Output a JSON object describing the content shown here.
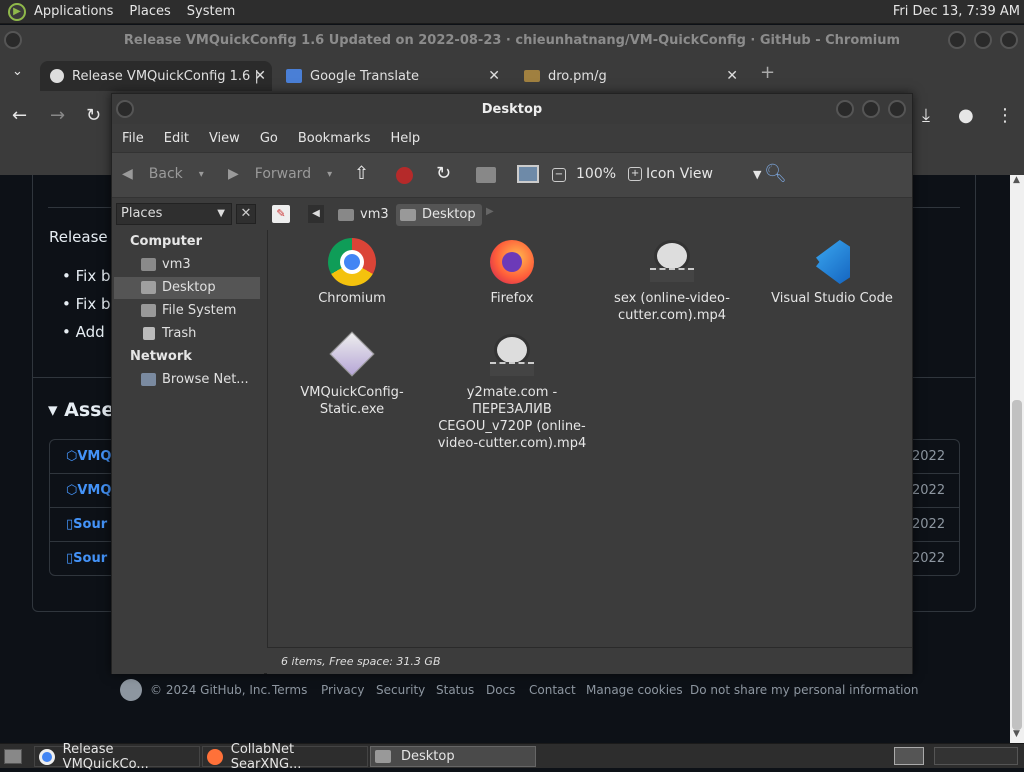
{
  "top_panel": {
    "applications": "Applications",
    "places": "Places",
    "system": "System",
    "clock": "Fri Dec 13,  7:39 AM"
  },
  "chromium": {
    "window_title": "Release VMQuickConfig 1.6 Updated on 2022-08-23 · chieunhatnang/VM-QuickConfig · GitHub - Chromium",
    "tabs": [
      {
        "label": "Release VMQuickConfig 1.6 |"
      },
      {
        "label": "Google Translate"
      },
      {
        "label": "dro.pm/g"
      }
    ]
  },
  "github": {
    "release_text": "Release",
    "bullets": [
      "Fix b",
      "Fix b",
      "Add"
    ],
    "assets_heading": "Asse",
    "assets": [
      {
        "name": "VMQ",
        "date": "2022"
      },
      {
        "name": "VMQ",
        "date": "2022"
      },
      {
        "name": "Sour",
        "date": "2022"
      },
      {
        "name": "Sour",
        "date": "2022"
      }
    ],
    "footer": {
      "copyright": "© 2024 GitHub, Inc.",
      "links": [
        "Terms",
        "Privacy",
        "Security",
        "Status",
        "Docs",
        "Contact",
        "Manage cookies",
        "Do not share my personal information"
      ]
    }
  },
  "file_manager": {
    "title": "Desktop",
    "menu": [
      "File",
      "Edit",
      "View",
      "Go",
      "Bookmarks",
      "Help"
    ],
    "toolbar": {
      "back": "Back",
      "forward": "Forward",
      "zoom": "100%",
      "view_mode": "Icon View"
    },
    "places_label": "Places",
    "breadcrumb": [
      "vm3",
      "Desktop"
    ],
    "sidebar": {
      "computer_heading": "Computer",
      "computer_items": [
        "vm3",
        "Desktop",
        "File System",
        "Trash"
      ],
      "network_heading": "Network",
      "network_items": [
        "Browse Net..."
      ]
    },
    "files": [
      {
        "name": "Chromium",
        "icon": "chromium-icon"
      },
      {
        "name": "Firefox",
        "icon": "firefox-icon"
      },
      {
        "name": "sex (online-video-cutter.com).mp4",
        "icon": "video-file-icon"
      },
      {
        "name": "Visual Studio Code",
        "icon": "vscode-icon"
      },
      {
        "name": "VMQuickConfig-Static.exe",
        "icon": "exe-file-icon"
      },
      {
        "name": "y2mate.com - ПЕРЕЗАЛИВ CEGOU_v720P (online-video-cutter.com).mp4",
        "icon": "video-file-icon"
      }
    ],
    "status": "6 items, Free space: 31.3 GB"
  },
  "taskbar": {
    "items": [
      {
        "label": "Release VMQuickCo..."
      },
      {
        "label": "CollabNet SearXNG..."
      },
      {
        "label": "Desktop"
      }
    ]
  }
}
